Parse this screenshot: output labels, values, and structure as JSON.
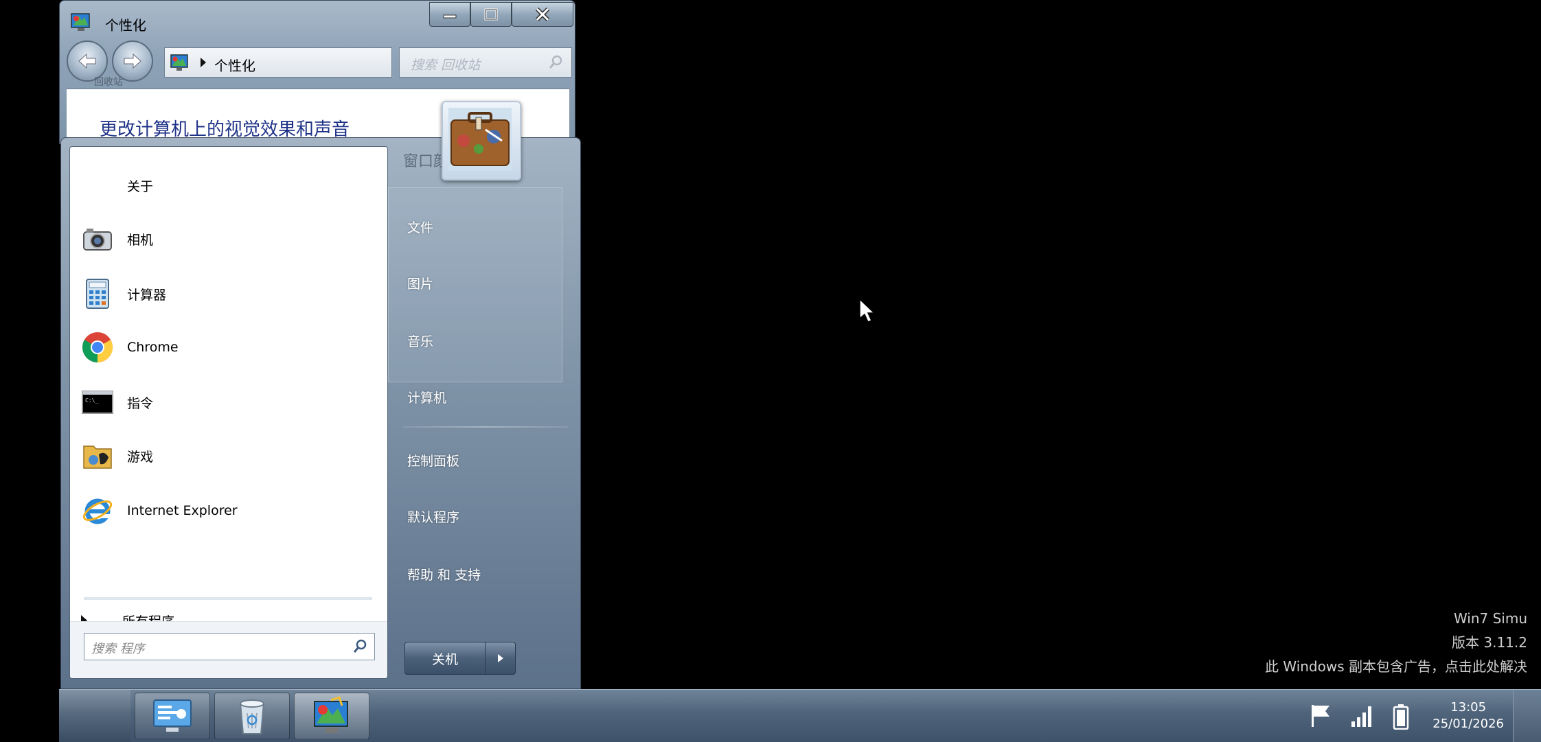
{
  "window": {
    "title": "个性化",
    "address": "个性化",
    "search_placeholder": "搜索 回收站",
    "heading": "更改计算机上的视觉效果和声音",
    "faint_desktop_label": "回收站",
    "faint_behind_text": "窗口颜"
  },
  "start_menu": {
    "programs": [
      {
        "label": "关于",
        "icon": "none"
      },
      {
        "label": "相机",
        "icon": "camera-icon"
      },
      {
        "label": "计算器",
        "icon": "calculator-icon"
      },
      {
        "label": "Chrome",
        "icon": "chrome-icon"
      },
      {
        "label": "指令",
        "icon": "command-prompt-icon"
      },
      {
        "label": "游戏",
        "icon": "games-folder-icon"
      },
      {
        "label": "Internet Explorer",
        "icon": "internet-explorer-icon"
      }
    ],
    "all_programs": "所有程序",
    "search_placeholder": "搜索 程序",
    "right_items": [
      "文件",
      "图片",
      "音乐",
      "计算机",
      "控制面板",
      "默认程序",
      "帮助 和 支持"
    ],
    "shutdown_label": "关机"
  },
  "watermark": {
    "line1": "Win7 Simu",
    "line2": "版本 3.11.2",
    "line3": "此 Windows 副本包含广告，点击此处解决"
  },
  "taskbar": {
    "buttons": [
      "control-panel-icon",
      "recycle-bin-icon",
      "personalization-icon"
    ],
    "active_button": "personalization-icon",
    "time": "13:05",
    "date": "25/01/2026"
  }
}
